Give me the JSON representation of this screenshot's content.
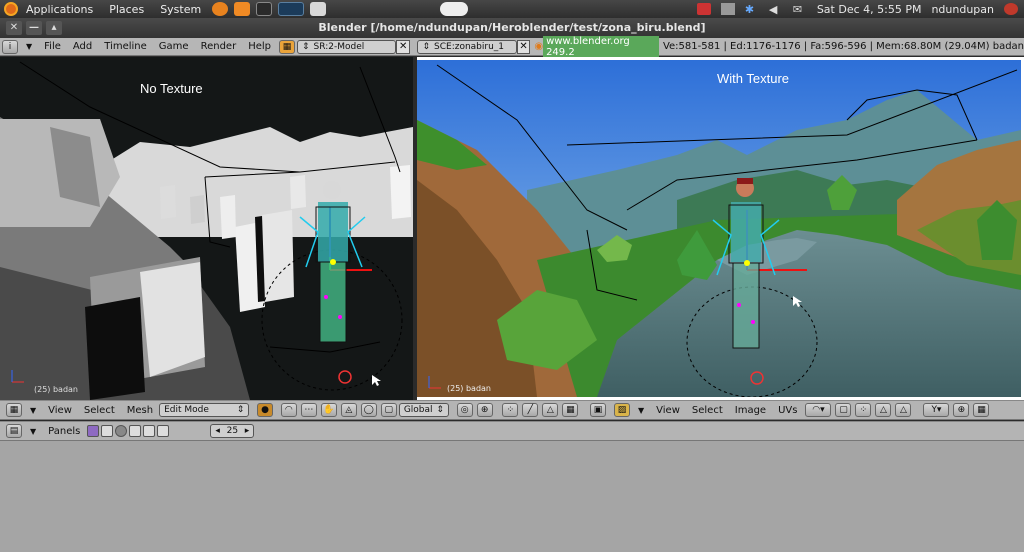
{
  "gnome_panel": {
    "menus": [
      "Applications",
      "Places",
      "System"
    ],
    "clock": "Sat Dec  4,  5:55 PM",
    "user": "ndundupan"
  },
  "window": {
    "title": "Blender [/home/ndundupan/Heroblender/test/zona_biru.blend]",
    "close_glyph": "✕",
    "minimize_glyph": "—"
  },
  "header": {
    "menus": [
      "File",
      "Add",
      "Timeline",
      "Game",
      "Render",
      "Help"
    ],
    "screen": "SR:2-Model",
    "scene": "SCE:zonabiru_1",
    "url": "www.blender.org 249.2",
    "stats": "Ve:581-581 | Ed:1176-1176 | Fa:596-596 | Mem:68.80M (29.04M) badan"
  },
  "viewports": {
    "left_label": "No Texture",
    "right_label": "With Texture",
    "left_corner": "(25) badan",
    "right_corner": "(25) badan"
  },
  "view3d_header": {
    "menus": [
      "View",
      "Select",
      "Mesh"
    ],
    "mode": "Edit Mode",
    "orientation": "Global"
  },
  "image_header": {
    "menus": [
      "View",
      "Select",
      "Image",
      "UVs"
    ]
  },
  "buttons_header": {
    "label": "Panels",
    "frame": "25"
  }
}
